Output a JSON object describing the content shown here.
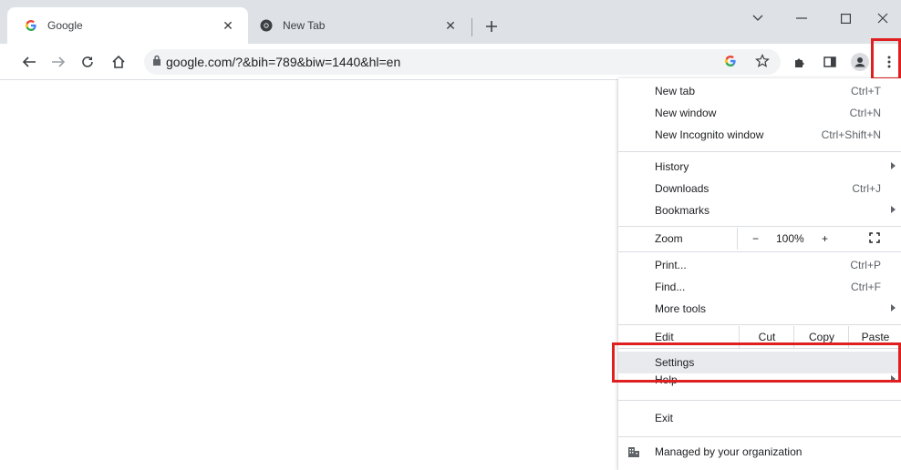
{
  "tabs": [
    {
      "title": "Google",
      "icon": "google-g-icon"
    },
    {
      "title": "New Tab",
      "icon": "chrome-icon"
    }
  ],
  "address_bar": {
    "url": "google.com/?&bih=789&biw=1440&hl=en"
  },
  "menu": {
    "new_tab": {
      "label": "New tab",
      "shortcut": "Ctrl+T"
    },
    "new_window": {
      "label": "New window",
      "shortcut": "Ctrl+N"
    },
    "new_incognito": {
      "label": "New Incognito window",
      "shortcut": "Ctrl+Shift+N"
    },
    "history": {
      "label": "History"
    },
    "downloads": {
      "label": "Downloads",
      "shortcut": "Ctrl+J"
    },
    "bookmarks": {
      "label": "Bookmarks"
    },
    "zoom": {
      "label": "Zoom",
      "minus": "−",
      "level": "100%",
      "plus": "+"
    },
    "print": {
      "label": "Print...",
      "shortcut": "Ctrl+P"
    },
    "find": {
      "label": "Find...",
      "shortcut": "Ctrl+F"
    },
    "more_tools": {
      "label": "More tools"
    },
    "edit": {
      "label": "Edit",
      "cut": "Cut",
      "copy": "Copy",
      "paste": "Paste"
    },
    "settings": {
      "label": "Settings"
    },
    "help": {
      "label": "Help"
    },
    "exit": {
      "label": "Exit"
    },
    "managed": {
      "label": "Managed by your organization"
    }
  },
  "colors": {
    "highlight_box": "#e02020",
    "menu_hover": "#e8eaed",
    "google_blue": "#4285f4"
  }
}
